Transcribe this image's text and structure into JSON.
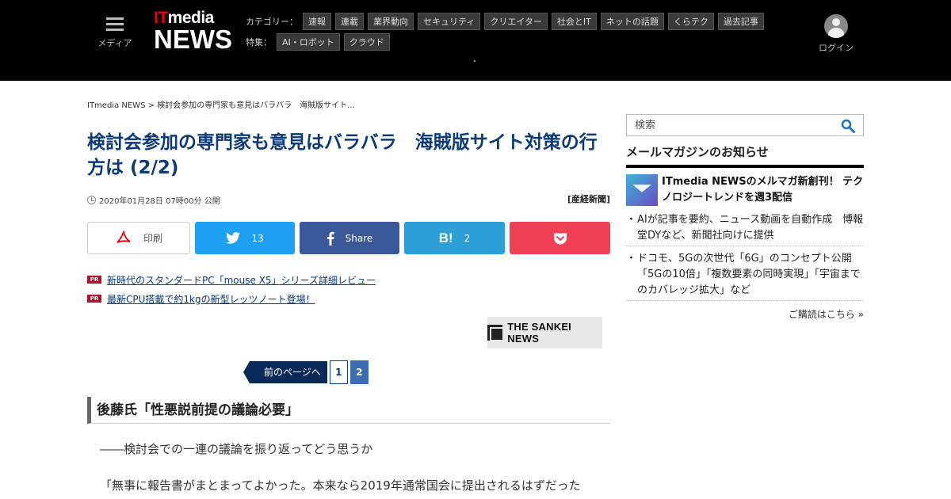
{
  "header": {
    "menu_label": "メディア",
    "logo_it": "IT",
    "logo_media": "media",
    "logo_news": "NEWS",
    "category_label": "カテゴリー：",
    "categories": [
      "速報",
      "連載",
      "業界動向",
      "セキュリティ",
      "クリエイター",
      "社会とIT",
      "ネットの話題",
      "くらテク",
      "過去記事"
    ],
    "feature_label": "特集：",
    "features": [
      "AI・ロボット",
      "クラウド"
    ],
    "login_label": "ログイン"
  },
  "breadcrumb": {
    "home": "ITmedia NEWS",
    "separator": ">",
    "current": "検討会参加の専門家も意見はバラバラ　海賊版サイト..."
  },
  "article": {
    "title": "検討会参加の専門家も意見はバラバラ　海賊版サイト対策の行方は (2/2)",
    "date": "2020年01月28日 07時00分 公開",
    "source": "[産経新聞]",
    "section_heading": "後藤氏「性悪説前提の議論必要」",
    "paragraph1": "――検討会での一連の議論を振り返ってどう思うか",
    "paragraph2": "「無事に報告書がまとまってよかった。本来なら2019年通常国会に提出されるはずだった"
  },
  "share": {
    "print_label": "印刷",
    "twitter_count": "13",
    "facebook_label": "Share",
    "hatena_count": "2",
    "colors": {
      "twitter": "#1da1f2",
      "facebook": "#3b5998",
      "hatena": "#2c9fd6",
      "pocket": "#ef4056"
    }
  },
  "pr": {
    "badge": "PR",
    "links": [
      "新時代のスタンダードPC「mouse X5」シリーズ詳細レビュー",
      "最新CPU搭載で約1kgの新型レッツノート登場！"
    ]
  },
  "partner": {
    "name": "THE SANKEI NEWS"
  },
  "pager": {
    "prev_label": "前のページへ",
    "pages": [
      "1",
      "2"
    ],
    "current": "2"
  },
  "sidebar": {
    "search_placeholder": "検索",
    "mailmag_title": "メールマガジンのお知らせ",
    "feature_text": "ITmedia NEWSのメルマガ新創刊！ テクノロジートレンドを週3配信",
    "items": [
      "AIが記事を要約、ニュース動画を自動作成　博報堂DYなど、新聞社向けに提供",
      "ドコモ、5Gの次世代「6G」のコンセプト公開　「5Gの10倍」「複数要素の同時実現」「宇宙までのカバレッジ拡大」など"
    ],
    "more_label": "ご購読はこちら »"
  },
  "colors": {
    "title": "#0a3a7a",
    "logo_red": "#e60012",
    "header_bg": "#000000"
  }
}
